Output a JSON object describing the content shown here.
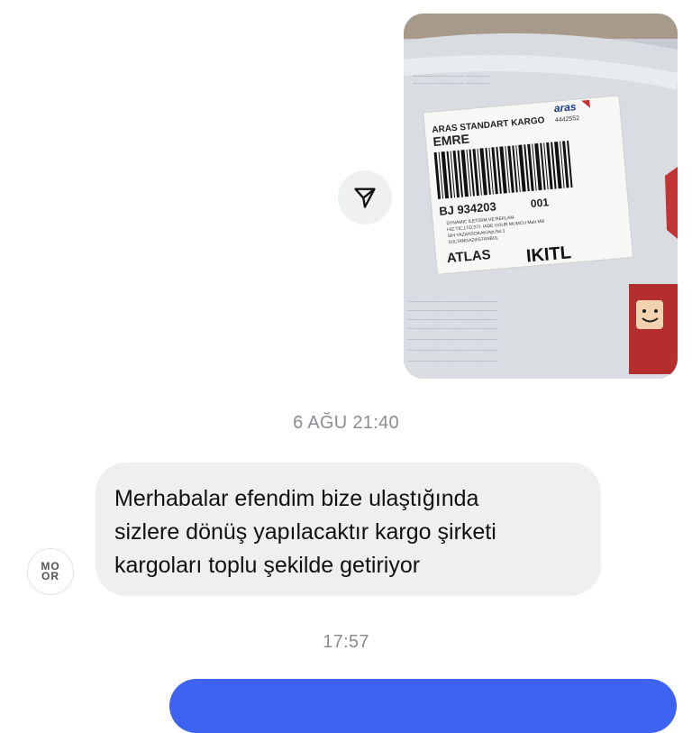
{
  "photo_message": {
    "label_lines": {
      "service": "ARAS STANDART KARGO",
      "receiver": "EMRE",
      "tracking": "BJ 934203",
      "code": "001",
      "sender_company": "DYNAMIC ILETISIM VE REKLAM",
      "sender_company_2": "HIZ.TIC.LTD.STI. IADE UGUR MUMCU Mah.Mili",
      "sender_address": "SIH YAZANSOKAK/Apt.No:1",
      "sender_city": "SULTANGAZI/ISTANBUL",
      "atlas": "ATLAS",
      "ikitl": "IKITL",
      "aras_logo": "aras",
      "aras_phone": "4442552"
    }
  },
  "share_icon": "paper-plane-icon",
  "timestamps": {
    "first": "6 AĞU 21:40",
    "second": "17:57"
  },
  "incoming_message": {
    "lines": [
      "Merhabalar efendim bize ulaştığında",
      "sizlere dönüş yapılacaktır kargo şirketi",
      "kargoları toplu şekilde getiriyor"
    ]
  },
  "avatar": {
    "text": "MOOR"
  },
  "colors": {
    "incoming_bubble": "#efeff1",
    "outgoing_bubble": "#3f63f1",
    "timestamp": "#8a8d91"
  }
}
